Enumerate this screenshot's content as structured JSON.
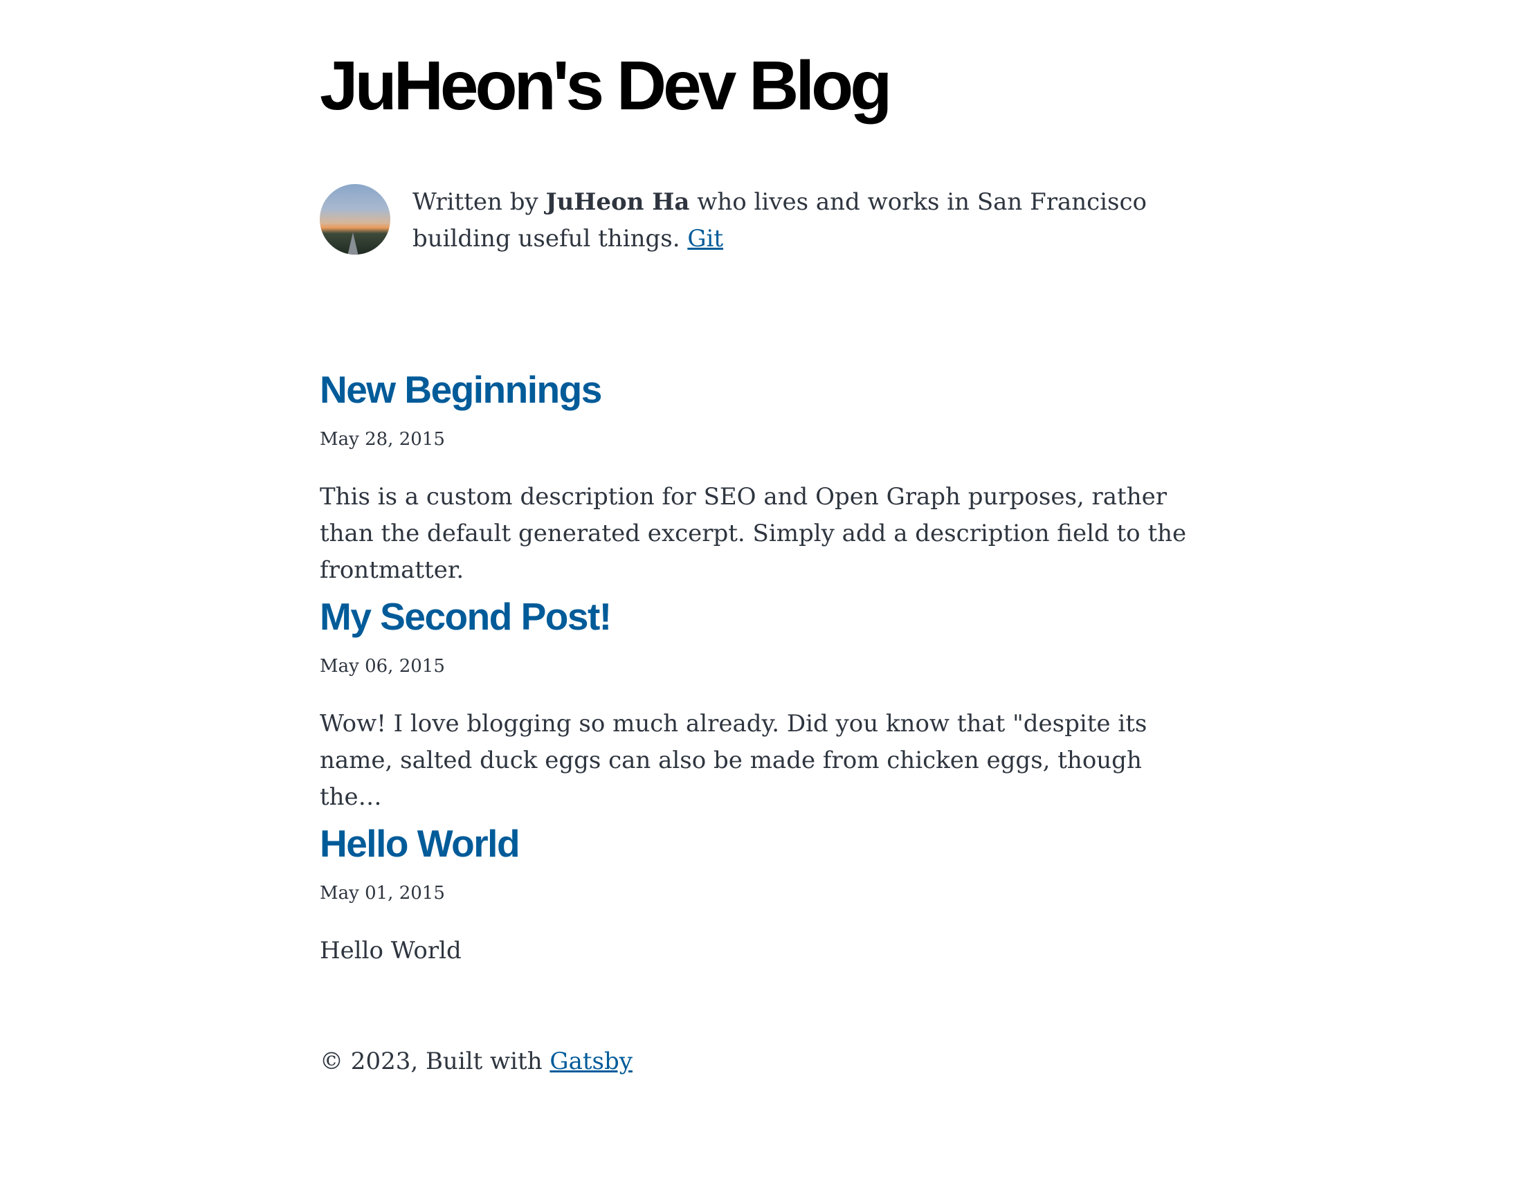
{
  "header": {
    "site_title": "JuHeon's Dev Blog"
  },
  "bio": {
    "prefix": "Written by ",
    "author": "JuHeon Ha",
    "suffix": " who lives and works in San Francisco building useful things. ",
    "link_label": "Git"
  },
  "posts": [
    {
      "title": "New Beginnings",
      "date": "May 28, 2015",
      "description": "This is a custom description for SEO and Open Graph purposes, rather than the default generated excerpt. Simply add a description field to the frontmatter."
    },
    {
      "title": "My Second Post!",
      "date": "May 06, 2015",
      "description": "Wow! I love blogging so much already. Did you know that \"despite its name, salted duck eggs can also be made from chicken eggs, though the…"
    },
    {
      "title": "Hello World",
      "date": "May 01, 2015",
      "description": "Hello World"
    }
  ],
  "footer": {
    "copyright": "© 2023, Built with ",
    "link_label": "Gatsby"
  },
  "colors": {
    "link": "#005b99",
    "text": "#2e353f",
    "title": "#000000"
  }
}
